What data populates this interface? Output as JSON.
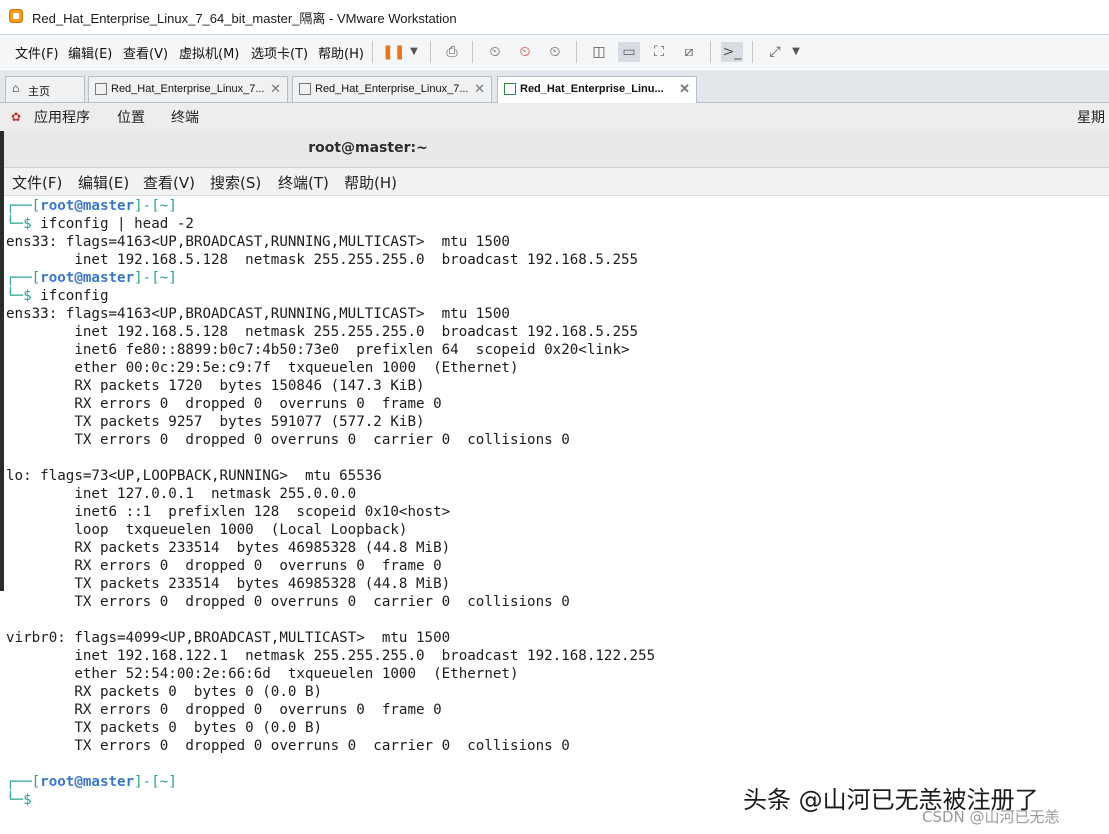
{
  "window": {
    "title": "Red_Hat_Enterprise_Linux_7_64_bit_master_隔离 - VMware Workstation"
  },
  "vmware_menu": [
    "文件(F)",
    "编辑(E)",
    "查看(V)",
    "虚拟机(M)",
    "选项卡(T)",
    "帮助(H)"
  ],
  "toolbar_icons": [
    "pause-icon",
    "dropdown-icon",
    "send-keys-icon",
    "snapshot-icon",
    "revert-snapshot-icon",
    "snapshot-manager-icon",
    "library-icon",
    "normal-view-icon",
    "fullscreen-icon",
    "unity-icon",
    "console-icon",
    "stretch-icon"
  ],
  "tabs": [
    {
      "label": "主页",
      "active": false
    },
    {
      "label": "Red_Hat_Enterprise_Linux_7...",
      "active": false
    },
    {
      "label": "Red_Hat_Enterprise_Linux_7...",
      "active": false
    },
    {
      "label": "Red_Hat_Enterprise_Linu...",
      "active": true
    }
  ],
  "gnome_bar": {
    "items": [
      "应用程序",
      "位置",
      "终端"
    ],
    "clock": "星期"
  },
  "terminal": {
    "title": "root@master:~",
    "menu": [
      "文件(F)",
      "编辑(E)",
      "查看(V)",
      "搜索(S)",
      "终端(T)",
      "帮助(H)"
    ],
    "prompt": {
      "user": "root",
      "at": "@",
      "host": "master",
      "dir": "~"
    },
    "commands": [
      "ifconfig | head -2",
      "ifconfig"
    ],
    "output_head": [
      "ens33: flags=4163<UP,BROADCAST,RUNNING,MULTICAST>  mtu 1500",
      "        inet 192.168.5.128  netmask 255.255.255.0  broadcast 192.168.5.255"
    ],
    "output_full": [
      "ens33: flags=4163<UP,BROADCAST,RUNNING,MULTICAST>  mtu 1500",
      "        inet 192.168.5.128  netmask 255.255.255.0  broadcast 192.168.5.255",
      "        inet6 fe80::8899:b0c7:4b50:73e0  prefixlen 64  scopeid 0x20<link>",
      "        ether 00:0c:29:5e:c9:7f  txqueuelen 1000  (Ethernet)",
      "        RX packets 1720  bytes 150846 (147.3 KiB)",
      "        RX errors 0  dropped 0  overruns 0  frame 0",
      "        TX packets 9257  bytes 591077 (577.2 KiB)",
      "        TX errors 0  dropped 0 overruns 0  carrier 0  collisions 0",
      "",
      "lo: flags=73<UP,LOOPBACK,RUNNING>  mtu 65536",
      "        inet 127.0.0.1  netmask 255.0.0.0",
      "        inet6 ::1  prefixlen 128  scopeid 0x10<host>",
      "        loop  txqueuelen 1000  (Local Loopback)",
      "        RX packets 233514  bytes 46985328 (44.8 MiB)",
      "        RX errors 0  dropped 0  overruns 0  frame 0",
      "        TX packets 233514  bytes 46985328 (44.8 MiB)",
      "        TX errors 0  dropped 0 overruns 0  carrier 0  collisions 0",
      "",
      "virbr0: flags=4099<UP,BROADCAST,MULTICAST>  mtu 1500",
      "        inet 192.168.122.1  netmask 255.255.255.0  broadcast 192.168.122.255",
      "        ether 52:54:00:2e:66:6d  txqueuelen 1000  (Ethernet)",
      "        RX packets 0  bytes 0 (0.0 B)",
      "        RX errors 0  dropped 0  overruns 0  frame 0",
      "        TX packets 0  bytes 0 (0.0 B)",
      "        TX errors 0  dropped 0 overruns 0  carrier 0  collisions 0"
    ]
  },
  "watermark": {
    "main": "头条 @山河已无恙被注册了",
    "sub": "CSDN @山河已无恙"
  },
  "colors": {
    "prompt_bracket": "#2aa198",
    "prompt_user": "#3a78c8"
  }
}
